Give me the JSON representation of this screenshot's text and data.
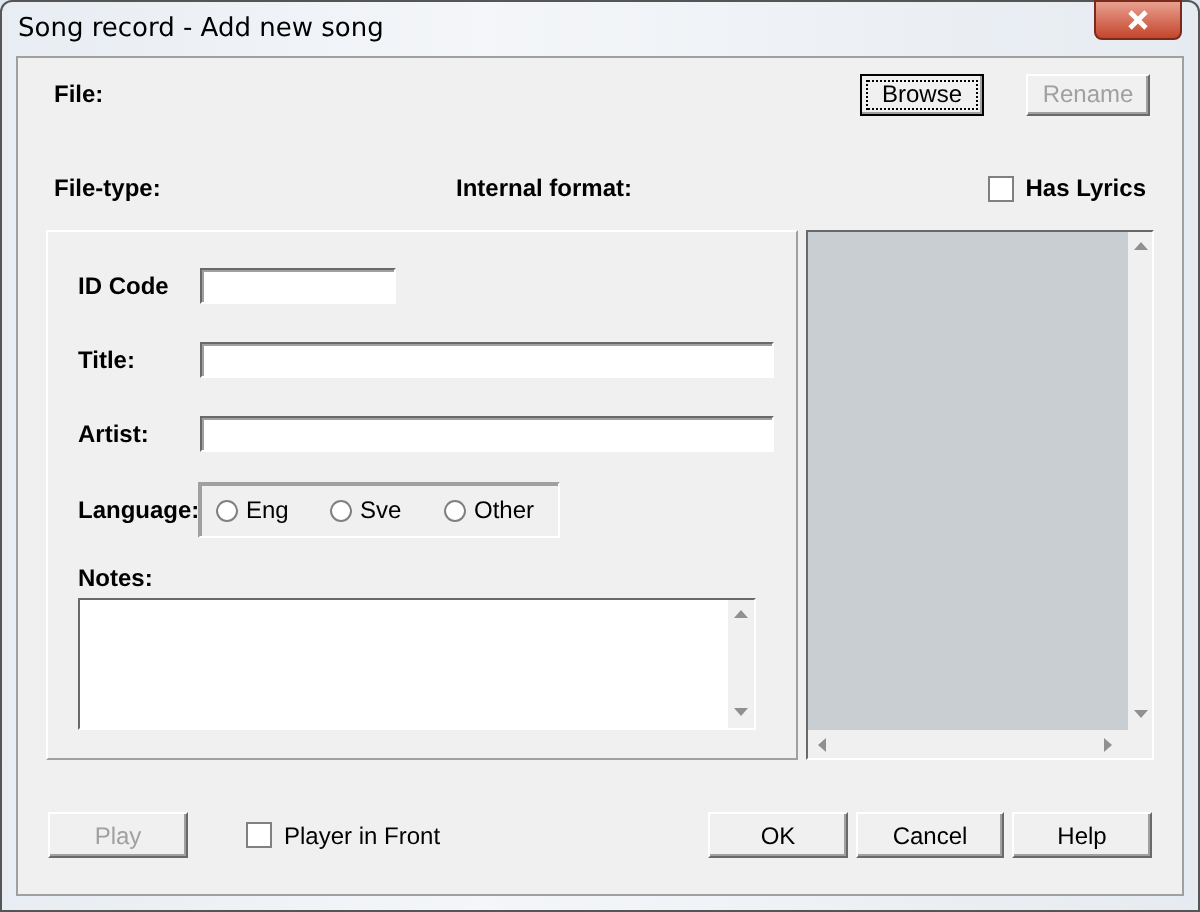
{
  "window": {
    "title": "Song record - Add new song"
  },
  "file_label": "File:",
  "top_buttons": [
    {
      "label": "Browse",
      "disabled": false,
      "focused": true
    },
    {
      "label": "Rename",
      "disabled": true,
      "focused": false
    }
  ],
  "file_type_label": "File-type:",
  "internal_format_label": "Internal format:",
  "has_lyrics": {
    "label": "Has Lyrics",
    "checked": false
  },
  "fields": [
    {
      "label": "ID Code",
      "kind": "short"
    },
    {
      "label": "Title:",
      "kind": "long"
    },
    {
      "label": "Artist:",
      "kind": "long"
    }
  ],
  "language": {
    "label": "Language:",
    "options": [
      {
        "label": "Eng",
        "selected": false
      },
      {
        "label": "Sve",
        "selected": false
      },
      {
        "label": "Other",
        "selected": false
      }
    ]
  },
  "notes": {
    "label": "Notes:"
  },
  "bottom_left_button": {
    "label": "Play",
    "disabled": true
  },
  "player_in_front": {
    "label": "Player in Front",
    "checked": false
  },
  "bottom_buttons": [
    {
      "label": "OK",
      "disabled": false
    },
    {
      "label": "Cancel",
      "disabled": false
    },
    {
      "label": "Help",
      "disabled": false
    }
  ]
}
